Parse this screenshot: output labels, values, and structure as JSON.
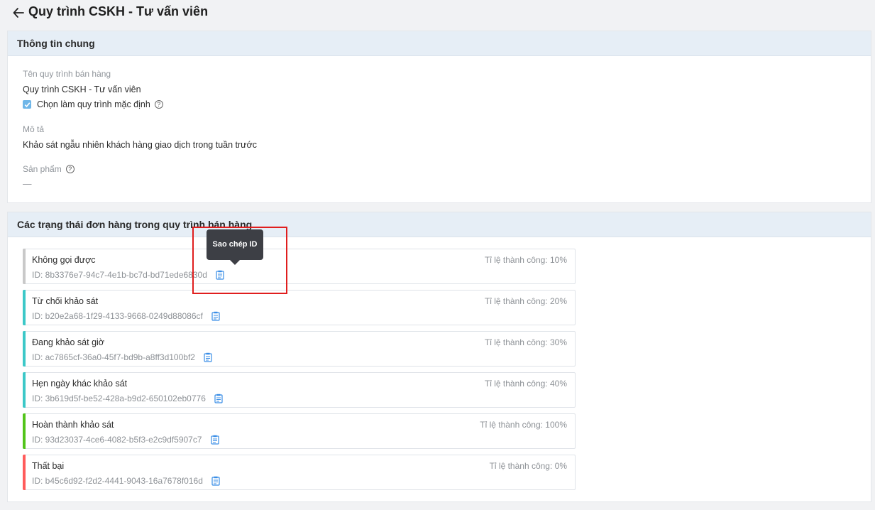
{
  "page": {
    "title": "Quy trình CSKH - Tư vấn viên"
  },
  "general": {
    "header": "Thông tin chung",
    "name_label": "Tên quy trình bán hàng",
    "name_value": "Quy trình CSKH - Tư vấn viên",
    "default_label": "Chọn làm quy trình mặc định",
    "default_checked": true,
    "desc_label": "Mô tả",
    "desc_value": "Khảo sát ngẫu nhiên khách hàng giao dịch trong tuần trước",
    "product_label": "Sản phẩm",
    "product_value": "—"
  },
  "statuses_section": {
    "header": "Các trạng thái đơn hàng trong quy trình bán hàng",
    "items": [
      {
        "name": "Không gọi được",
        "id": "ID: 8b3376e7-94c7-4e1b-bc7d-bd71ede6830d",
        "rate": "Tỉ lệ thành công: 10%",
        "color": "#c9c9c9"
      },
      {
        "name": "Từ chối khảo sát",
        "id": "ID: b20e2a68-1f29-4133-9668-0249d88086cf",
        "rate": "Tỉ lệ thành công: 20%",
        "color": "#3cc8c8"
      },
      {
        "name": "Đang khảo sát giờ",
        "id": "ID: ac7865cf-36a0-45f7-bd9b-a8ff3d100bf2",
        "rate": "Tỉ lệ thành công: 30%",
        "color": "#3cc8c8"
      },
      {
        "name": "Hẹn ngày khác khảo sát",
        "id": "ID: 3b619d5f-be52-428a-b9d2-650102eb0776",
        "rate": "Tỉ lệ thành công: 40%",
        "color": "#3cc8c8"
      },
      {
        "name": "Hoàn thành khảo sát",
        "id": "ID: 93d23037-4ce6-4082-b5f3-e2c9df5907c7",
        "rate": "Tỉ lệ thành công: 100%",
        "color": "#52c41a"
      },
      {
        "name": "Thất bại",
        "id": "ID: b45c6d92-f2d2-4441-9043-16a7678f016d",
        "rate": "Tỉ lệ thành công: 0%",
        "color": "#ff5b5b"
      }
    ]
  },
  "tooltip": {
    "text": "Sao chép ID"
  },
  "icons": {
    "back": "arrow-left-icon",
    "help": "question-circle-icon",
    "copy": "clipboard-icon",
    "check": "check-icon"
  },
  "colors": {
    "header_bg": "#e6eef6",
    "accent": "#1890ff",
    "highlight": "#e01e1e"
  }
}
